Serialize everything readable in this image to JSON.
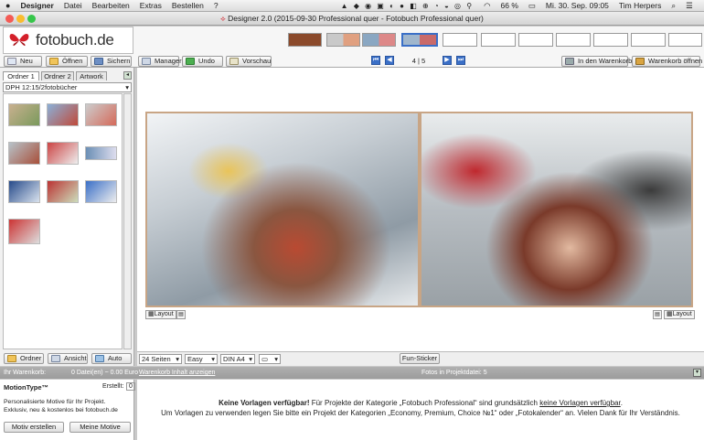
{
  "menubar": {
    "app": "Designer",
    "items": [
      "Datei",
      "Bearbeiten",
      "Extras",
      "Bestellen",
      "?"
    ],
    "battery": "66 %",
    "clock": "Mi. 30. Sep. 09:05",
    "user": "Tim Herpers"
  },
  "window": {
    "title": "Designer 2.0 (2015-09-30 Professional quer - Fotobuch Professional quer)"
  },
  "logo": {
    "text": "fotobuch.de"
  },
  "toolbar": {
    "new": "Neu",
    "open": "Öffnen",
    "save": "Sichern",
    "manager": "Manager",
    "undo": "Undo",
    "preview": "Vorschau",
    "page_indicator": "4 | 5",
    "add_to_cart": "In den Warenkorb",
    "open_cart": "Warenkorb öffnen"
  },
  "left_panel": {
    "tabs": [
      "Ordner 1",
      "Ordner 2",
      "Artwork"
    ],
    "folder_select": "DPH 12:15/2fotobücher",
    "bottom_buttons": {
      "folder": "Ordner",
      "view": "Ansicht",
      "auto": "Auto"
    }
  },
  "canvas": {
    "layout_label": "Layout"
  },
  "bottom_controls": {
    "pages": "24 Seiten",
    "mode": "Easy",
    "format": "DIN A4",
    "fun_sticker": "Fun-Sticker"
  },
  "status": {
    "cart_label": "Ihr Warenkorb:",
    "cart_value": "0 Datei(en) ~ 0.00 Euro",
    "cart_link": "Warenkorb Inhalt anzeigen",
    "photos_in_project": "Fotos in Projektdatei: 5"
  },
  "motion": {
    "title": "MotionType™",
    "created_label": "Erstellt:",
    "created_value": "0",
    "desc_line1": "Personalisierte Motive für Ihr Projekt.",
    "desc_line2": "Exklusiv, neu & kostenlos bei fotobuch.de",
    "create_btn": "Motiv erstellen",
    "my_btn": "Meine Motive"
  },
  "message": {
    "line1_bold": "Keine Vorlagen verfügbar!",
    "line1_rest": " Für Projekte der Kategorie „Fotobuch Professional“ sind grundsätzlich ",
    "line1_link": "keine Vorlagen verfügbar",
    "line1_end": ".",
    "line2": "Um Vorlagen zu verwenden legen Sie bitte ein Projekt der Kategorien „Economy, Premium, Choice №1“ oder „Fotokalender“ an. Vielen Dank für Ihr Verständnis."
  },
  "colors": {
    "accent": "#3a6fc7",
    "page_border": "#c8a585",
    "brand_red": "#d4202a"
  }
}
